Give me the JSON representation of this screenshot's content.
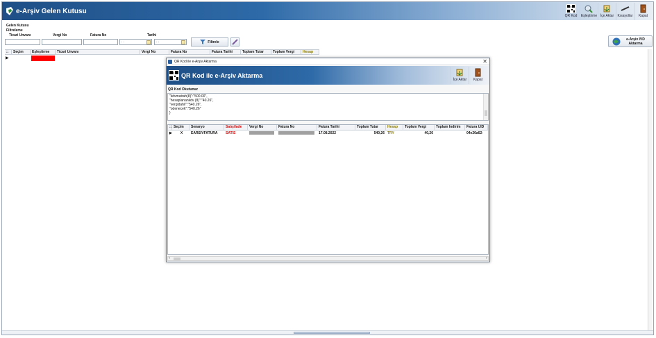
{
  "window": {
    "title": "e-Arşiv Gelen Kutusu"
  },
  "toolbar": [
    {
      "label": "QR Kod",
      "icon": "qr-code-icon"
    },
    {
      "label": "Eşleştirme",
      "icon": "match-icon"
    },
    {
      "label": "İçe Aktar",
      "icon": "import-icon"
    },
    {
      "label": "Kısayollar",
      "icon": "shortcuts-icon"
    },
    {
      "label": "Kapat",
      "icon": "exit-door-icon"
    }
  ],
  "filter": {
    "section": "Gelen Kutusu",
    "subsection": "Filtreleme",
    "ticari_label": "Ticari Unvanı",
    "vergi_label": "Vergi No",
    "fatura_label": "Fatura No",
    "tarih_label": "Tarihi",
    "date_from": ". .",
    "date_to": ". .",
    "filter_button": "Filtrele",
    "ivd_button": "e-Arşiv IVD Aktarma"
  },
  "grid": {
    "headers": [
      "Seçim",
      "Eşleştirme",
      "Ticari Unvanı",
      "Vergi No",
      "Fatura No",
      "Fatura Tarihi",
      "Toplam Tutar",
      "Toplam Vergi",
      "Hesap"
    ]
  },
  "modal": {
    "caption": "QR Kod ile e-Arşiv Aktarma",
    "title": "QR Kod ile e-Arşiv Aktarma",
    "tools": [
      {
        "label": "İçe Aktar",
        "icon": "import-icon"
      },
      {
        "label": "Kapat",
        "icon": "exit-door-icon"
      }
    ],
    "qr_label": "QR Kod Okutunuz",
    "qr_lines": [
      "\"kdvmatrah(8)\":\"500.00\",",
      "\"hesaplanankdv (8)\":\"40.26\",",
      "\"vergidahil\":\"540.26\",",
      "\"odenecek\":\"540.26\"",
      "}"
    ],
    "grid_headers": [
      "Seçim",
      "Senaryo",
      "Satış/İade",
      "Vergi No",
      "Fatura No",
      "Fatura Tarihi",
      "Toplam Tutar",
      "Hesap",
      "Toplam Vergi",
      "Toplam İndirim",
      "Fatura UID"
    ],
    "row": {
      "secim": "X",
      "senaryo": "EARSIVFATURA",
      "satis": "SATIS",
      "tarih": "17.08.2022",
      "tutar": "540,26",
      "hesap": "TRY",
      "vergi": "40,26",
      "indirim": "",
      "uid": "04e26a62-"
    }
  },
  "colors": {
    "accent": "#1f4f86",
    "alert": "#ff0000",
    "satis": "#e00000",
    "hesap": "#8a7a00"
  }
}
